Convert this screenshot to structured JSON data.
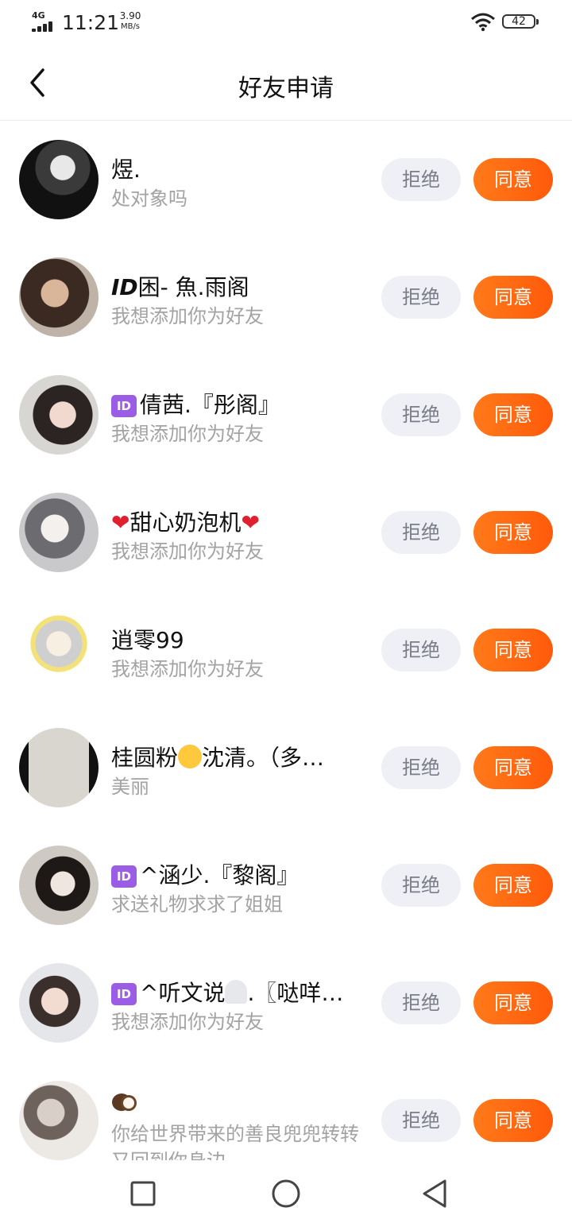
{
  "status_bar": {
    "network": "4G",
    "time": "11:21",
    "speed_value": "3.90",
    "speed_unit": "MB/s",
    "battery": "42",
    "wifi_icon": "wifi-icon",
    "signal_icon": "signal-icon"
  },
  "header": {
    "title": "好友申请",
    "back_icon": "chevron-left-icon"
  },
  "buttons": {
    "reject": "拒绝",
    "accept": "同意"
  },
  "requests": [
    {
      "name": "煜.",
      "message": "处对象吗"
    },
    {
      "name_prefix": "ID",
      "name": "困- 魚.雨阁",
      "message": "我想添加你为好友"
    },
    {
      "name_prefix": "ID",
      "name": "倩茜.『彤阁』",
      "message": "我想添加你为好友"
    },
    {
      "name_heart": "❤",
      "name": "甜心奶泡机",
      "message": "我想添加你为好友"
    },
    {
      "name": "逍零99",
      "message": "我想添加你为好友"
    },
    {
      "name_before": "桂圆粉",
      "name_after": "沈清。（多…",
      "message": "美丽"
    },
    {
      "name_prefix": "ID",
      "name": "^涵少.『黎阁』",
      "message": "求送礼物求求了姐姐"
    },
    {
      "name_prefix": "ID",
      "name_before": "^听文说",
      "name_after": ".〖哒咩…",
      "message": "我想添加你为好友"
    },
    {
      "name": "",
      "message": "你给世界带来的善良兜兜转转又回到你身边"
    }
  ],
  "nav": {
    "recents_icon": "square-icon",
    "home_icon": "circle-icon",
    "back_icon": "triangle-back-icon"
  }
}
